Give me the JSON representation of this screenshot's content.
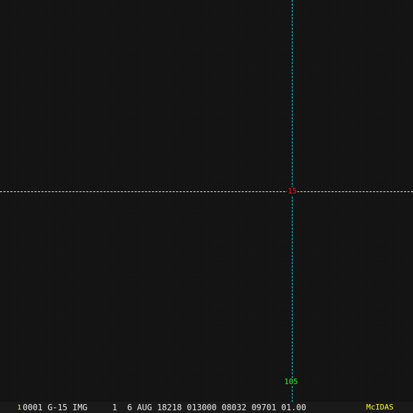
{
  "overlay": {
    "latitude_label": "15",
    "longitude_label": "105",
    "line_color": "#00e5ff",
    "lat_label_color": "#ff1a1a",
    "lon_label_color": "#22ff22"
  },
  "status_bar": {
    "frame_number": "1",
    "text": "0001 G-15 IMG     1  6 AUG 18218 013000 08032 09701 01.00",
    "logo": "McIDAS"
  }
}
